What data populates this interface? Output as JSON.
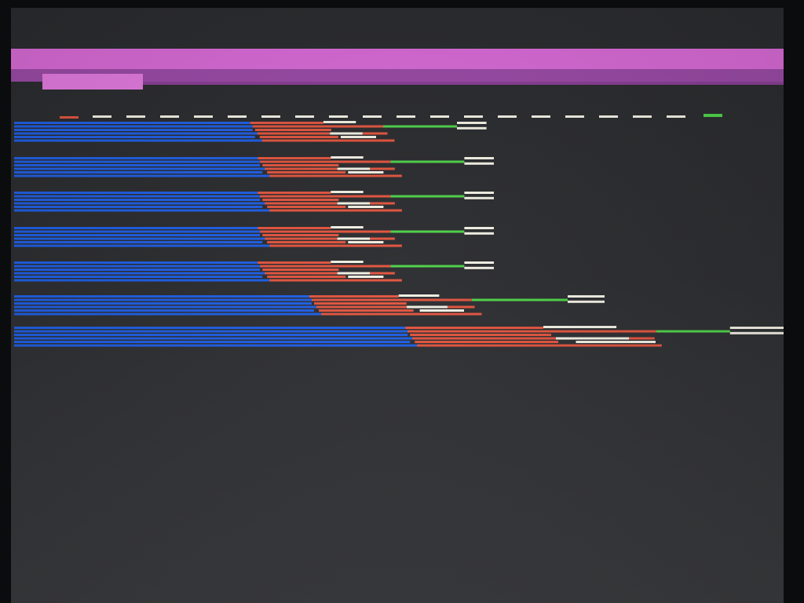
{
  "colors": {
    "background": "#2c2d30",
    "band_primary": "#d86ad6",
    "band_secondary": "#9a4aa6",
    "band_highlight": "#e37ae0",
    "stage_blue": "#1f5fe6",
    "stage_red": "#e2553f",
    "stage_green": "#4fd24a",
    "stage_white": "#f2f0e4",
    "marker_orange": "#e2553f",
    "marker_green": "#4fd24a",
    "dash": "#f2f0e4"
  },
  "icons": {
    "start_marker": "orange-dash-marker",
    "end_marker": "green-dash-marker"
  },
  "chart_data": {
    "type": "bar",
    "orientation": "horizontal",
    "groups": 7,
    "series": [
      {
        "color": "blue",
        "values": [
          0.32,
          0.33,
          0.33,
          0.33,
          0.33,
          0.4,
          0.53
        ]
      },
      {
        "color": "red",
        "values": [
          0.18,
          0.18,
          0.18,
          0.18,
          0.18,
          0.22,
          0.34
        ]
      },
      {
        "color": "green",
        "values": [
          0.1,
          0.1,
          0.1,
          0.1,
          0.1,
          0.13,
          0.1
        ]
      },
      {
        "color": "white",
        "values": [
          0.04,
          0.04,
          0.04,
          0.04,
          0.04,
          0.05,
          0.09
        ]
      }
    ],
    "grid": false,
    "legend": "none"
  }
}
